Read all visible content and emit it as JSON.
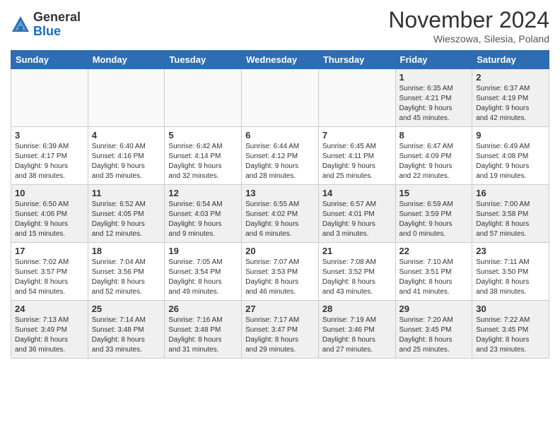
{
  "logo": {
    "general": "General",
    "blue": "Blue"
  },
  "title": "November 2024",
  "location": "Wieszowa, Silesia, Poland",
  "weekdays": [
    "Sunday",
    "Monday",
    "Tuesday",
    "Wednesday",
    "Thursday",
    "Friday",
    "Saturday"
  ],
  "weeks": [
    [
      {
        "day": "",
        "info": ""
      },
      {
        "day": "",
        "info": ""
      },
      {
        "day": "",
        "info": ""
      },
      {
        "day": "",
        "info": ""
      },
      {
        "day": "",
        "info": ""
      },
      {
        "day": "1",
        "info": "Sunrise: 6:35 AM\nSunset: 4:21 PM\nDaylight: 9 hours\nand 45 minutes."
      },
      {
        "day": "2",
        "info": "Sunrise: 6:37 AM\nSunset: 4:19 PM\nDaylight: 9 hours\nand 42 minutes."
      }
    ],
    [
      {
        "day": "3",
        "info": "Sunrise: 6:39 AM\nSunset: 4:17 PM\nDaylight: 9 hours\nand 38 minutes."
      },
      {
        "day": "4",
        "info": "Sunrise: 6:40 AM\nSunset: 4:16 PM\nDaylight: 9 hours\nand 35 minutes."
      },
      {
        "day": "5",
        "info": "Sunrise: 6:42 AM\nSunset: 4:14 PM\nDaylight: 9 hours\nand 32 minutes."
      },
      {
        "day": "6",
        "info": "Sunrise: 6:44 AM\nSunset: 4:12 PM\nDaylight: 9 hours\nand 28 minutes."
      },
      {
        "day": "7",
        "info": "Sunrise: 6:45 AM\nSunset: 4:11 PM\nDaylight: 9 hours\nand 25 minutes."
      },
      {
        "day": "8",
        "info": "Sunrise: 6:47 AM\nSunset: 4:09 PM\nDaylight: 9 hours\nand 22 minutes."
      },
      {
        "day": "9",
        "info": "Sunrise: 6:49 AM\nSunset: 4:08 PM\nDaylight: 9 hours\nand 19 minutes."
      }
    ],
    [
      {
        "day": "10",
        "info": "Sunrise: 6:50 AM\nSunset: 4:06 PM\nDaylight: 9 hours\nand 15 minutes."
      },
      {
        "day": "11",
        "info": "Sunrise: 6:52 AM\nSunset: 4:05 PM\nDaylight: 9 hours\nand 12 minutes."
      },
      {
        "day": "12",
        "info": "Sunrise: 6:54 AM\nSunset: 4:03 PM\nDaylight: 9 hours\nand 9 minutes."
      },
      {
        "day": "13",
        "info": "Sunrise: 6:55 AM\nSunset: 4:02 PM\nDaylight: 9 hours\nand 6 minutes."
      },
      {
        "day": "14",
        "info": "Sunrise: 6:57 AM\nSunset: 4:01 PM\nDaylight: 9 hours\nand 3 minutes."
      },
      {
        "day": "15",
        "info": "Sunrise: 6:59 AM\nSunset: 3:59 PM\nDaylight: 9 hours\nand 0 minutes."
      },
      {
        "day": "16",
        "info": "Sunrise: 7:00 AM\nSunset: 3:58 PM\nDaylight: 8 hours\nand 57 minutes."
      }
    ],
    [
      {
        "day": "17",
        "info": "Sunrise: 7:02 AM\nSunset: 3:57 PM\nDaylight: 8 hours\nand 54 minutes."
      },
      {
        "day": "18",
        "info": "Sunrise: 7:04 AM\nSunset: 3:56 PM\nDaylight: 8 hours\nand 52 minutes."
      },
      {
        "day": "19",
        "info": "Sunrise: 7:05 AM\nSunset: 3:54 PM\nDaylight: 8 hours\nand 49 minutes."
      },
      {
        "day": "20",
        "info": "Sunrise: 7:07 AM\nSunset: 3:53 PM\nDaylight: 8 hours\nand 46 minutes."
      },
      {
        "day": "21",
        "info": "Sunrise: 7:08 AM\nSunset: 3:52 PM\nDaylight: 8 hours\nand 43 minutes."
      },
      {
        "day": "22",
        "info": "Sunrise: 7:10 AM\nSunset: 3:51 PM\nDaylight: 8 hours\nand 41 minutes."
      },
      {
        "day": "23",
        "info": "Sunrise: 7:11 AM\nSunset: 3:50 PM\nDaylight: 8 hours\nand 38 minutes."
      }
    ],
    [
      {
        "day": "24",
        "info": "Sunrise: 7:13 AM\nSunset: 3:49 PM\nDaylight: 8 hours\nand 36 minutes."
      },
      {
        "day": "25",
        "info": "Sunrise: 7:14 AM\nSunset: 3:48 PM\nDaylight: 8 hours\nand 33 minutes."
      },
      {
        "day": "26",
        "info": "Sunrise: 7:16 AM\nSunset: 3:48 PM\nDaylight: 8 hours\nand 31 minutes."
      },
      {
        "day": "27",
        "info": "Sunrise: 7:17 AM\nSunset: 3:47 PM\nDaylight: 8 hours\nand 29 minutes."
      },
      {
        "day": "28",
        "info": "Sunrise: 7:19 AM\nSunset: 3:46 PM\nDaylight: 8 hours\nand 27 minutes."
      },
      {
        "day": "29",
        "info": "Sunrise: 7:20 AM\nSunset: 3:45 PM\nDaylight: 8 hours\nand 25 minutes."
      },
      {
        "day": "30",
        "info": "Sunrise: 7:22 AM\nSunset: 3:45 PM\nDaylight: 8 hours\nand 23 minutes."
      }
    ]
  ]
}
